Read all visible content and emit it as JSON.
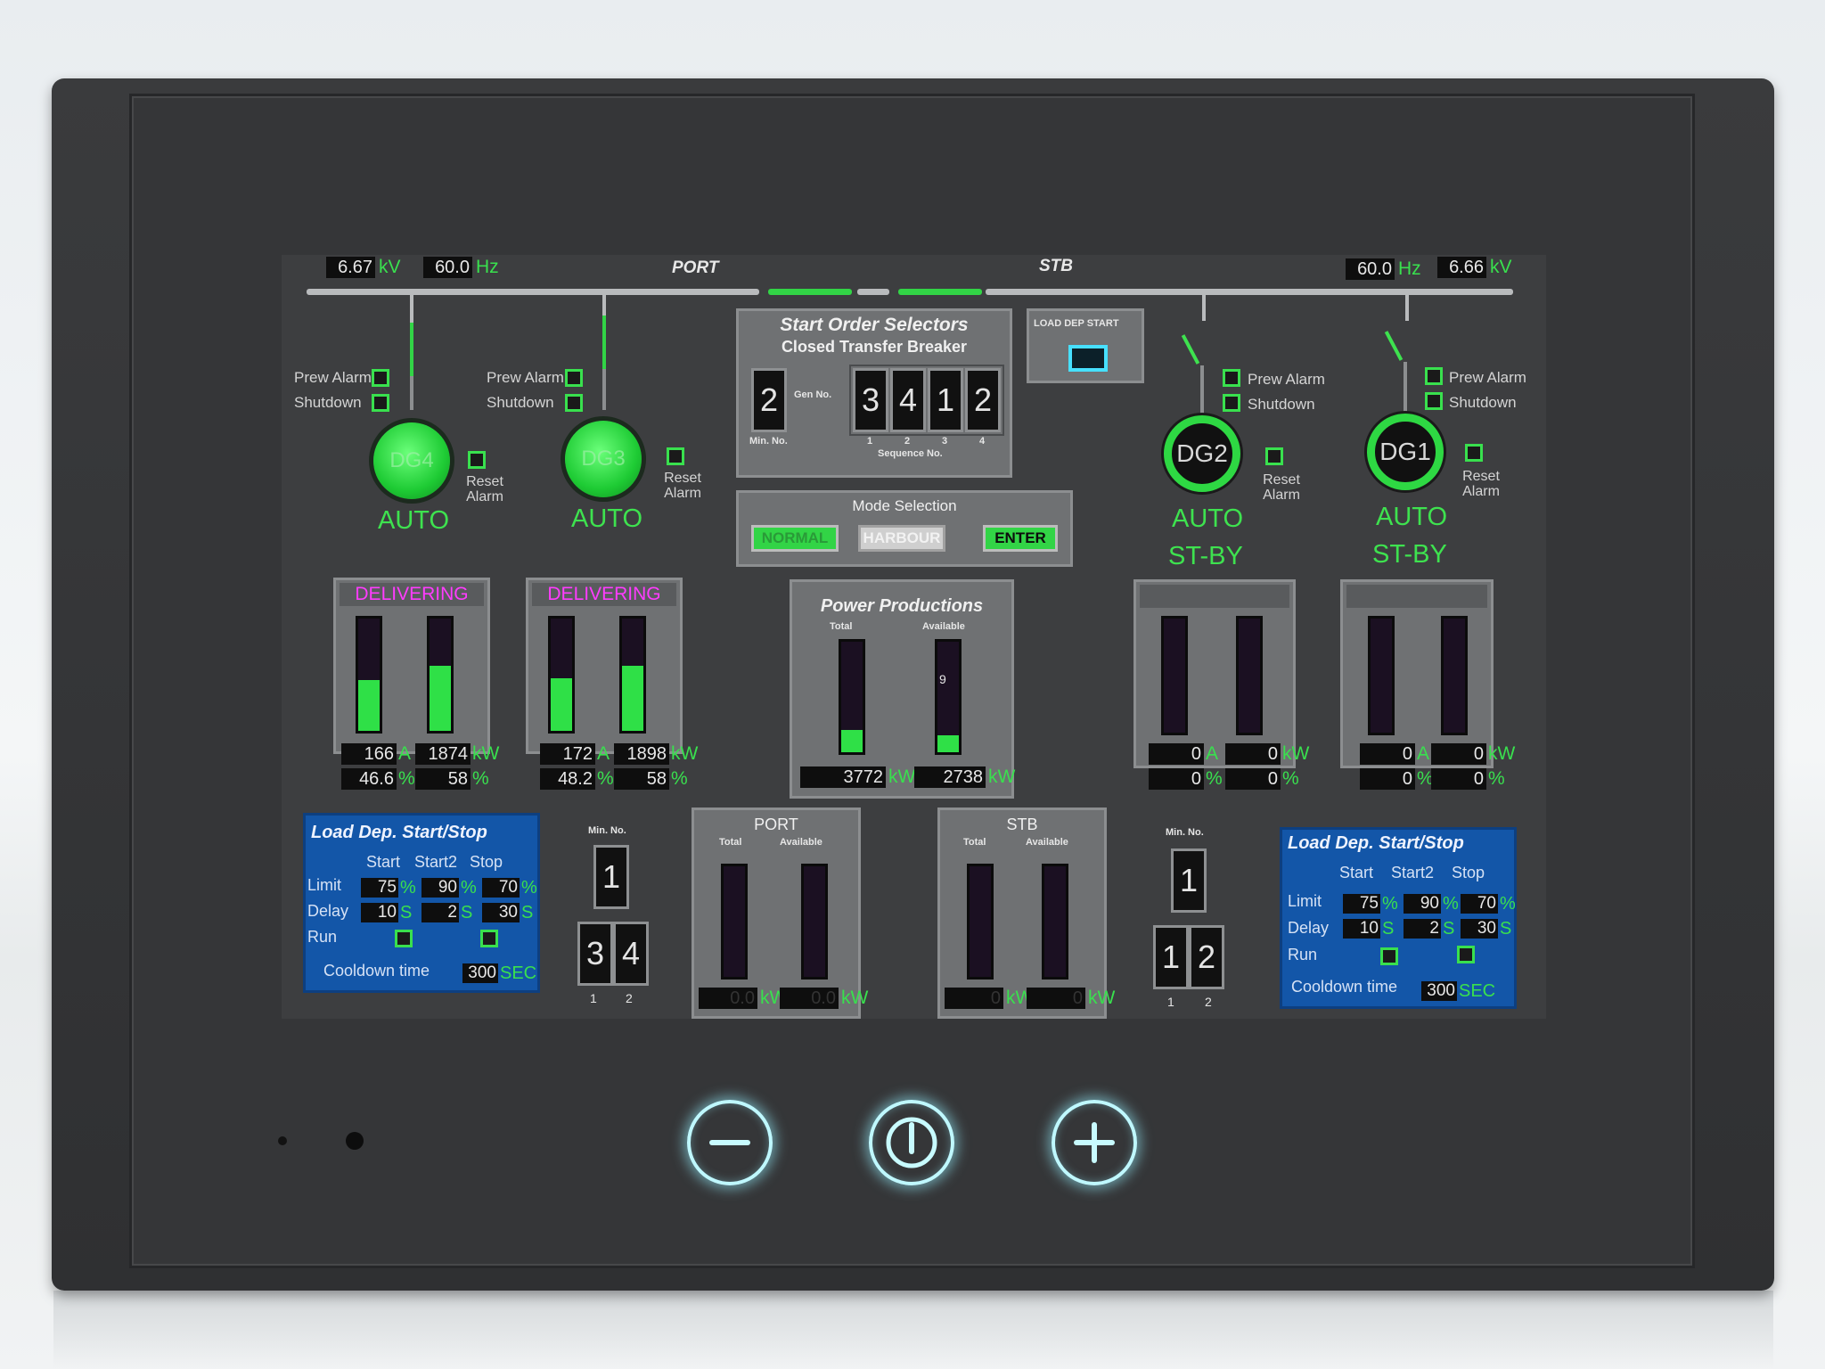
{
  "bus": {
    "port": {
      "label": "PORT",
      "kv": "6.67",
      "kv_unit": "kV",
      "hz": "60.0",
      "hz_unit": "Hz"
    },
    "stb": {
      "label": "STB",
      "kv": "6.66",
      "kv_unit": "kV",
      "hz": "60.0",
      "hz_unit": "Hz"
    }
  },
  "generators": [
    {
      "name": "DG4",
      "prew_alarm": "Prew Alarm",
      "shutdown": "Shutdown",
      "reset": "Reset Alarm",
      "mode": "AUTO",
      "status": "",
      "delivering": "DELIVERING",
      "current": "166",
      "current_unit": "A",
      "power": "1874",
      "power_unit": "kW",
      "load_pct": "46.6",
      "pct2": "58",
      "pct_unit": "%",
      "bar1": 0.45,
      "bar2": 0.58
    },
    {
      "name": "DG3",
      "prew_alarm": "Prew Alarm",
      "shutdown": "Shutdown",
      "reset": "Reset Alarm",
      "mode": "AUTO",
      "status": "",
      "delivering": "DELIVERING",
      "current": "172",
      "current_unit": "A",
      "power": "1898",
      "power_unit": "kW",
      "load_pct": "48.2",
      "pct2": "58",
      "pct_unit": "%",
      "bar1": 0.47,
      "bar2": 0.58
    },
    {
      "name": "DG2",
      "prew_alarm": "Prew Alarm",
      "shutdown": "Shutdown",
      "reset": "Reset Alarm",
      "mode": "AUTO",
      "status": "ST-BY",
      "delivering": "",
      "current": "0",
      "current_unit": "A",
      "power": "0",
      "power_unit": "kW",
      "load_pct": "0",
      "pct2": "0",
      "pct_unit": "%",
      "bar1": 0,
      "bar2": 0
    },
    {
      "name": "DG1",
      "prew_alarm": "Prew Alarm",
      "shutdown": "Shutdown",
      "reset": "Reset Alarm",
      "mode": "AUTO",
      "status": "ST-BY",
      "delivering": "",
      "current": "0",
      "current_unit": "A",
      "power": "0",
      "power_unit": "kW",
      "load_pct": "0",
      "pct2": "0",
      "pct_unit": "%",
      "bar1": 0,
      "bar2": 0
    }
  ],
  "start_order": {
    "title": "Start Order Selectors",
    "subtitle": "Closed Transfer Breaker",
    "min_no": "2",
    "min_label": "Min. No.",
    "gen_no_label": "Gen No.",
    "sequence": [
      "3",
      "4",
      "1",
      "2"
    ],
    "seq_idx": [
      "1",
      "2",
      "3",
      "4"
    ],
    "seq_label": "Sequence No."
  },
  "load_dep_start": {
    "label": "LOAD DEP START"
  },
  "mode_selection": {
    "title": "Mode Selection",
    "btn1": "NORMAL",
    "btn2": "HARBOUR",
    "enter": "ENTER"
  },
  "power_productions": {
    "title": "Power Productions",
    "total_label": "Total",
    "available_label": "Available",
    "total": "3772",
    "available": "2738",
    "unit": "kW",
    "marker": "9",
    "bar_total": 0.2,
    "bar_avail": 0.15
  },
  "port_panel": {
    "title": "PORT",
    "total_label": "Total",
    "available_label": "Available",
    "total": "0.0",
    "available": "0.0",
    "unit": "kW"
  },
  "stb_panel": {
    "title": "STB",
    "total_label": "Total",
    "available_label": "Available",
    "total": "0",
    "available": "0",
    "unit": "kW"
  },
  "min_port": {
    "label": "Min. No.",
    "min": "1",
    "a": "3",
    "b": "4",
    "ia": "1",
    "ib": "2"
  },
  "min_stb": {
    "label": "Min. No.",
    "min": "1",
    "a": "1",
    "b": "2",
    "ia": "1",
    "ib": "2"
  },
  "load_dep_port": {
    "title": "Load Dep. Start/Stop",
    "h_start": "Start",
    "h_start2": "Start2",
    "h_stop": "Stop",
    "limit": "Limit",
    "delay": "Delay",
    "run": "Run",
    "limit_vals": [
      "75",
      "90",
      "70"
    ],
    "pct": "%",
    "delay_vals": [
      "10",
      "2",
      "30"
    ],
    "s": "S",
    "cooldown": "Cooldown time",
    "cooldown_val": "300",
    "sec": "SEC"
  },
  "load_dep_stb": {
    "title": "Load Dep. Start/Stop",
    "h_start": "Start",
    "h_start2": "Start2",
    "h_stop": "Stop",
    "limit": "Limit",
    "delay": "Delay",
    "run": "Run",
    "limit_vals": [
      "75",
      "90",
      "70"
    ],
    "pct": "%",
    "delay_vals": [
      "10",
      "2",
      "30"
    ],
    "s": "S",
    "cooldown": "Cooldown time",
    "cooldown_val": "300",
    "sec": "SEC"
  },
  "hw_buttons": [
    "minus-icon",
    "power-icon",
    "plus-icon"
  ]
}
